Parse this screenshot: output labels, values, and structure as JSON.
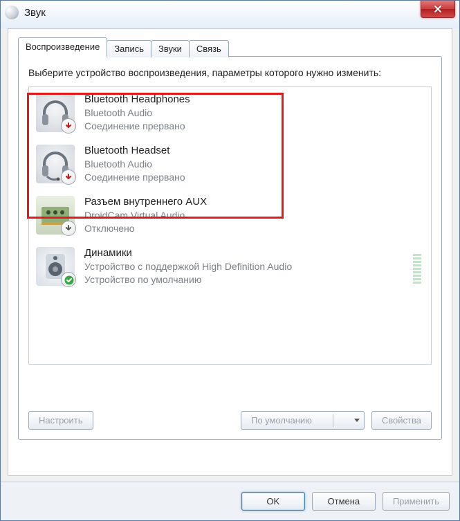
{
  "window": {
    "title": "Звук"
  },
  "tabs": [
    {
      "label": "Воспроизведение",
      "active": true
    },
    {
      "label": "Запись"
    },
    {
      "label": "Звуки"
    },
    {
      "label": "Связь"
    }
  ],
  "instruction": "Выберите устройство воспроизведения, параметры которого нужно изменить:",
  "devices": [
    {
      "name": "Bluetooth Headphones",
      "sub": "Bluetooth Audio",
      "status": "Соединение прервано",
      "icon": "headphones",
      "badge": "down-red"
    },
    {
      "name": "Bluetooth Headset",
      "sub": "Bluetooth Audio",
      "status": "Соединение прервано",
      "icon": "headset",
      "badge": "down-red"
    },
    {
      "name": "Разъем внутреннего  AUX",
      "sub": "DroidCam Virtual Audio",
      "status": "Отключено",
      "icon": "card",
      "badge": "down-gray"
    },
    {
      "name": "Динамики",
      "sub": "Устройство с поддержкой High Definition Audio",
      "status": "Устройство по умолчанию",
      "icon": "speaker",
      "badge": "check",
      "vu": true
    }
  ],
  "buttons": {
    "configure": "Настроить",
    "default": "По умолчанию",
    "properties": "Свойства",
    "ok": "OK",
    "cancel": "Отмена",
    "apply": "Применить"
  }
}
